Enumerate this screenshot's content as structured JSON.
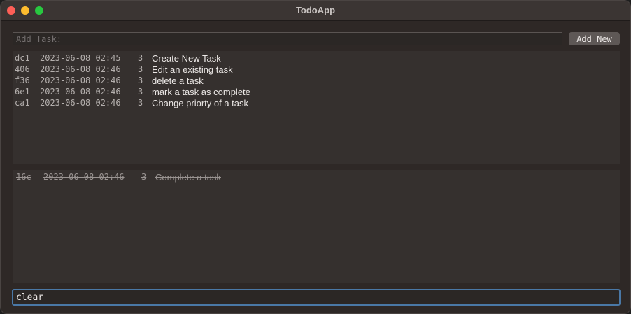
{
  "window": {
    "title": "TodoApp"
  },
  "add_task": {
    "placeholder": "Add Task:",
    "value": "",
    "button_label": "Add New"
  },
  "active_tasks": [
    {
      "id": "dc1",
      "date": "2023-06-08 02:45",
      "priority": "3",
      "name": "Create New Task"
    },
    {
      "id": "406",
      "date": "2023-06-08 02:46",
      "priority": "3",
      "name": "Edit an existing task"
    },
    {
      "id": "f36",
      "date": "2023-06-08 02:46",
      "priority": "3",
      "name": "delete a task"
    },
    {
      "id": "6e1",
      "date": "2023-06-08 02:46",
      "priority": "3",
      "name": "mark a task as complete"
    },
    {
      "id": "ca1",
      "date": "2023-06-08 02:46",
      "priority": "3",
      "name": "Change priorty of a task"
    }
  ],
  "completed_tasks": [
    {
      "id": "16c",
      "date": "2023-06-08 02:46",
      "priority": "3",
      "name": "Complete a task"
    }
  ],
  "command": {
    "value": "clear"
  }
}
